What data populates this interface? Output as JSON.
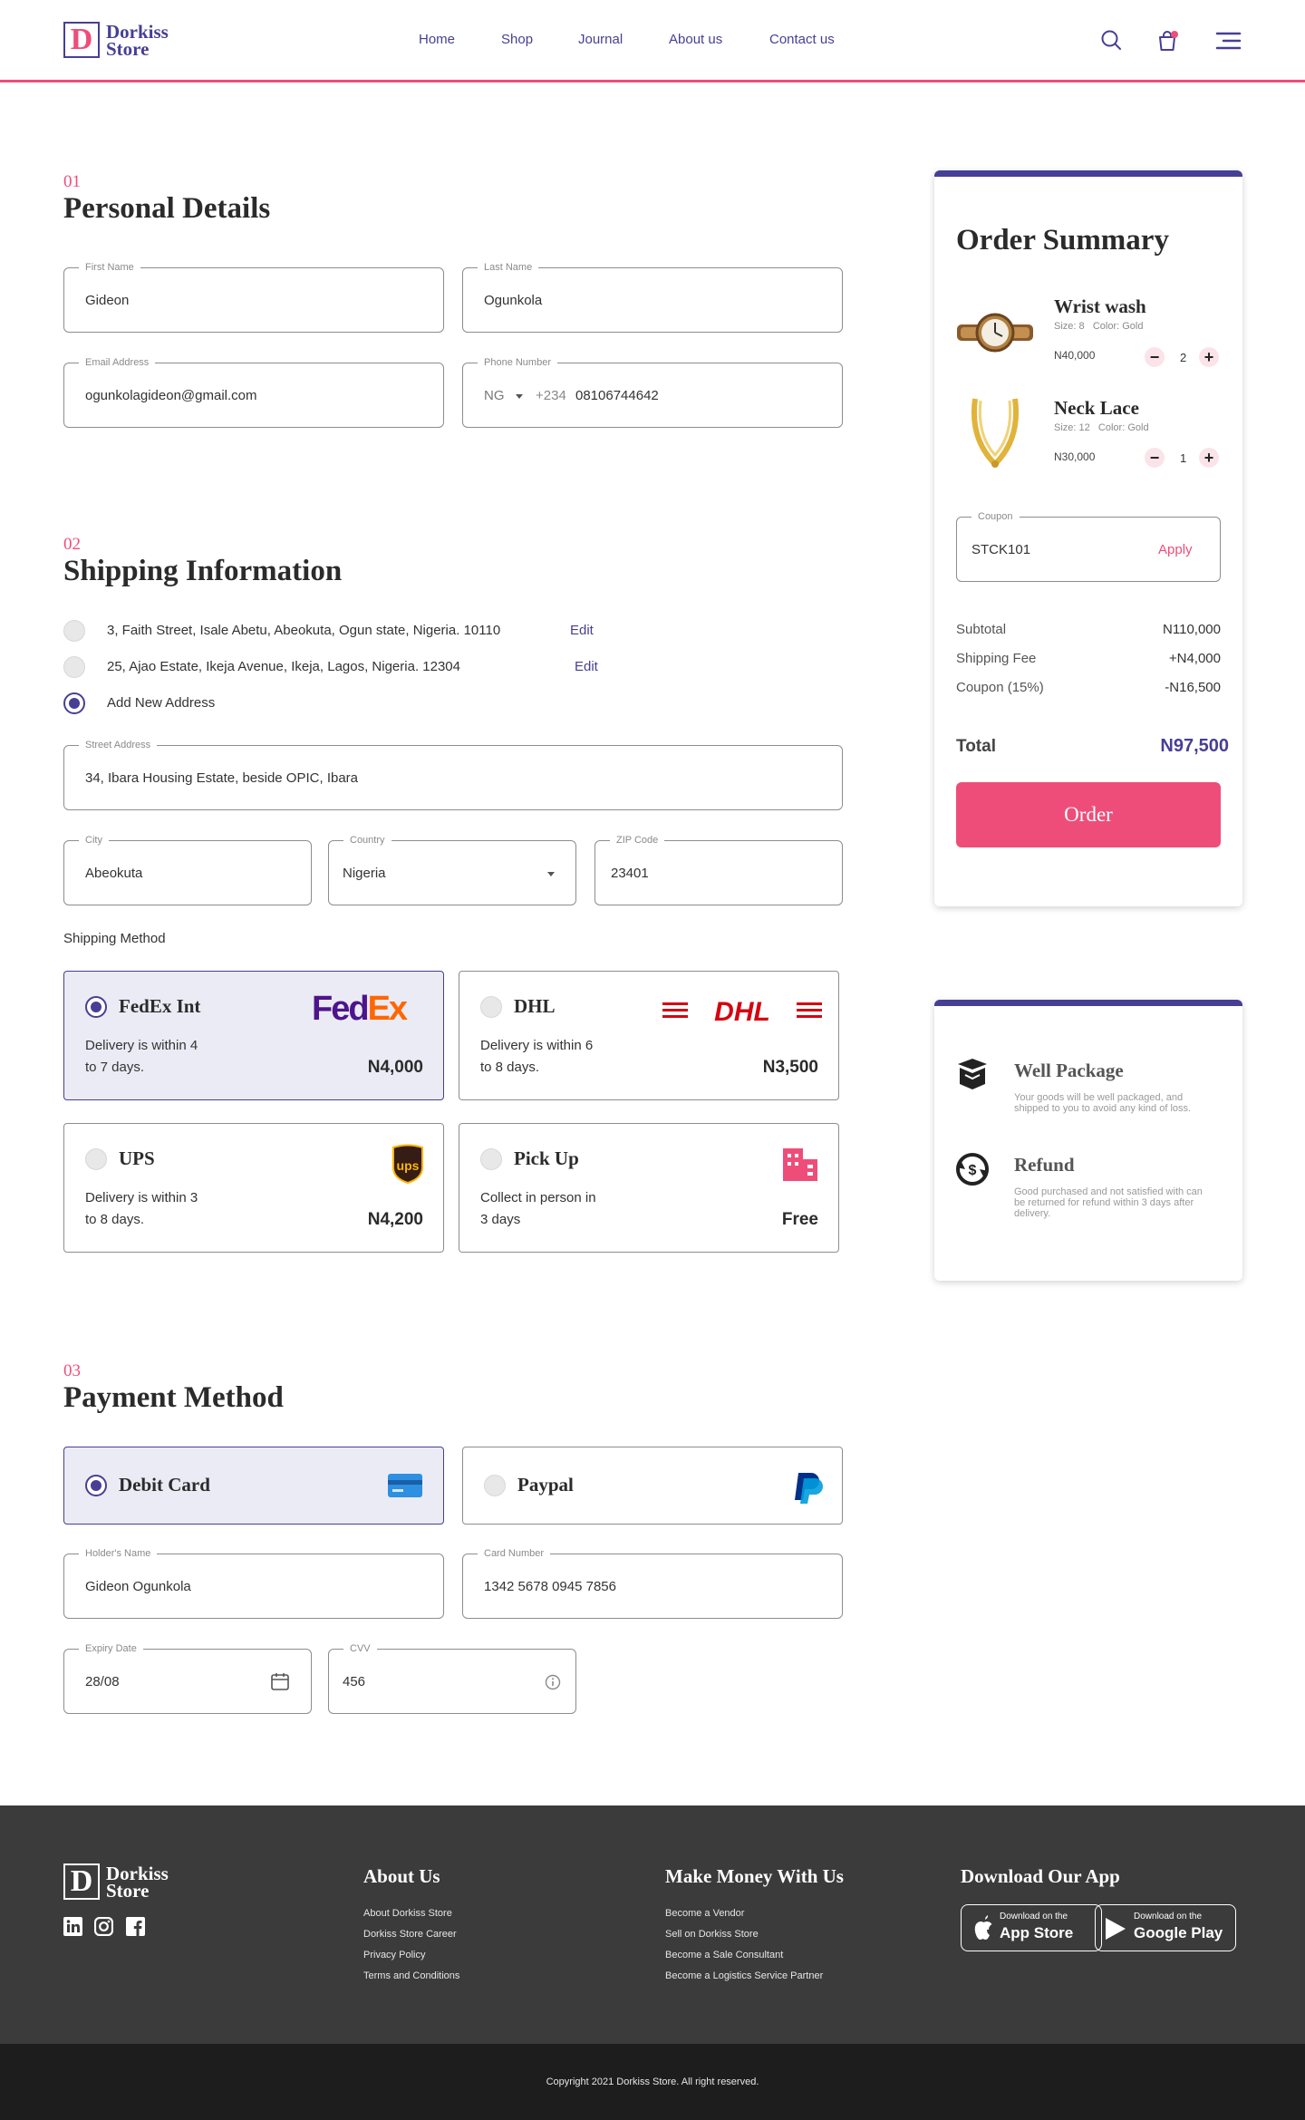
{
  "brand": {
    "logo_letter": "D",
    "name_line1": "Dorkiss",
    "name_line2": "Store"
  },
  "nav": {
    "items": [
      "Home",
      "Shop",
      "Journal",
      "About us",
      "Contact us"
    ],
    "cart_count": ""
  },
  "personal": {
    "step": "01",
    "title": "Personal Details",
    "first_name": {
      "label": "First Name",
      "value": "Gideon"
    },
    "last_name": {
      "label": "Last Name",
      "value": "Ogunkola"
    },
    "email": {
      "label": "Email Address",
      "value": "ogunkolagideon@gmail.com"
    },
    "phone": {
      "label": "Phone Number",
      "country": "NG",
      "code": "+234",
      "value": "08106744642"
    }
  },
  "shipping": {
    "step": "02",
    "title": "Shipping Information",
    "addresses": [
      {
        "text": "3, Faith Street, Isale Abetu, Abeokuta, Ogun state, Nigeria. 10110",
        "edit": "Edit"
      },
      {
        "text": "25, Ajao Estate, Ikeja Avenue, Ikeja, Lagos, Nigeria. 12304",
        "edit": "Edit"
      }
    ],
    "add_new": "Add New Address",
    "street": {
      "label": "Street Address",
      "value": "34, Ibara Housing Estate, beside OPIC, Ibara"
    },
    "city": {
      "label": "City",
      "value": "Abeokuta"
    },
    "country": {
      "label": "Country",
      "value": "Nigeria"
    },
    "zip": {
      "label": "ZIP Code",
      "value": "23401"
    },
    "method_label": "Shipping Method",
    "methods": [
      {
        "name": "FedEx Int",
        "desc1": "Delivery is within 4",
        "desc2": "to 7 days.",
        "price": "N4,000",
        "selected": true
      },
      {
        "name": "DHL",
        "desc1": "Delivery is within 6",
        "desc2": "to 8 days.",
        "price": "N3,500",
        "selected": false
      },
      {
        "name": "UPS",
        "desc1": "Delivery is within 3",
        "desc2": "to 8 days.",
        "price": "N4,200",
        "selected": false
      },
      {
        "name": "Pick Up",
        "desc1": "Collect in person in",
        "desc2": "3 days",
        "price": "Free",
        "selected": false
      }
    ],
    "logos": {
      "fedex_fed": "Fed",
      "fedex_ex": "Ex",
      "dhl": "DHL",
      "ups": "ups"
    }
  },
  "payment": {
    "step": "03",
    "title": "Payment Method",
    "options": [
      {
        "name": "Debit Card",
        "selected": true
      },
      {
        "name": "Paypal",
        "selected": false
      }
    ],
    "holder": {
      "label": "Holder's Name",
      "value": "Gideon Ogunkola"
    },
    "card_number": {
      "label": "Card Number",
      "value": "1342 5678 0945 7856"
    },
    "expiry": {
      "label": "Expiry Date",
      "value": "28/08"
    },
    "cvv": {
      "label": "CVV",
      "value": "456"
    }
  },
  "summary": {
    "title": "Order Summary",
    "items": [
      {
        "name": "Wrist wash",
        "size": "Size: 8",
        "color": "Color: Gold",
        "price": "N40,000",
        "qty": "2"
      },
      {
        "name": "Neck Lace",
        "size": "Size: 12",
        "color": "Color: Gold",
        "price": "N30,000",
        "qty": "1"
      }
    ],
    "coupon": {
      "label": "Coupon",
      "value": "STCK101",
      "apply": "Apply"
    },
    "rows": [
      {
        "label": "Subtotal",
        "value": "N110,000"
      },
      {
        "label": "Shipping Fee",
        "value": "+N4,000"
      },
      {
        "label": "Coupon (15%)",
        "value": "-N16,500"
      }
    ],
    "total_label": "Total",
    "total_value": "N97,500",
    "order_button": "Order"
  },
  "features": [
    {
      "title": "Well Package",
      "desc": "Your goods will be well packaged, and shipped to you to avoid any kind of loss."
    },
    {
      "title": "Refund",
      "desc": "Good purchased and not satisfied with can be returned for refund within 3 days after delivery."
    }
  ],
  "footer": {
    "about": {
      "title": "About Us",
      "links": [
        "About Dorkiss Store",
        "Dorkiss Store Career",
        "Privacy Policy",
        "Terms and Conditions"
      ]
    },
    "money": {
      "title": "Make Money With Us",
      "links": [
        "Become a Vendor",
        "Sell on Dorkiss Store",
        "Become a Sale Consultant",
        "Become a Logistics Service Partner"
      ]
    },
    "app": {
      "title": "Download Our App",
      "appstore": {
        "small": "Download on the",
        "big": "App Store"
      },
      "googleplay": {
        "small": "Download on the",
        "big": "Google Play"
      }
    },
    "copyright": "Copyright 2021 Dorkiss Store. All right reserved."
  },
  "colors": {
    "primary": "#463f95",
    "accent": "#ee4d7a",
    "footer": "#3b3b3b",
    "subfooter": "#1d1d1d",
    "selected_bg": "#ebebf5"
  }
}
